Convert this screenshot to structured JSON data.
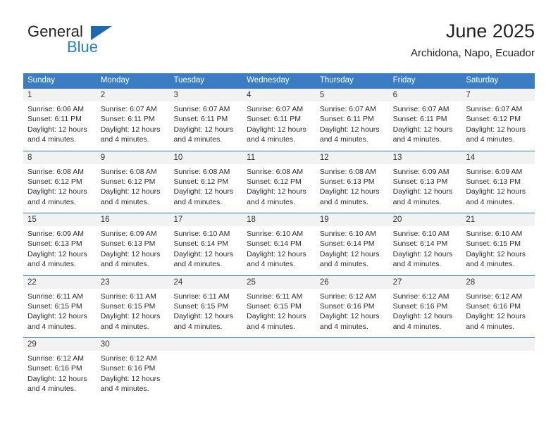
{
  "brand": {
    "name_top": "General",
    "name_bottom": "Blue",
    "triangle_color": "#1c68b3",
    "blue_color": "#1c7fd4"
  },
  "header": {
    "title": "June 2025",
    "subtitle": "Archidona, Napo, Ecuador"
  },
  "theme": {
    "header_blue": "#3a7dc4",
    "day_band_gray": "#f2f2f2",
    "text_color": "#2b2b2b"
  },
  "weekdays": [
    "Sunday",
    "Monday",
    "Tuesday",
    "Wednesday",
    "Thursday",
    "Friday",
    "Saturday"
  ],
  "weeks": [
    [
      {
        "day": "1",
        "sunrise": "Sunrise: 6:06 AM",
        "sunset": "Sunset: 6:11 PM",
        "daylight_1": "Daylight: 12 hours",
        "daylight_2": "and 4 minutes."
      },
      {
        "day": "2",
        "sunrise": "Sunrise: 6:07 AM",
        "sunset": "Sunset: 6:11 PM",
        "daylight_1": "Daylight: 12 hours",
        "daylight_2": "and 4 minutes."
      },
      {
        "day": "3",
        "sunrise": "Sunrise: 6:07 AM",
        "sunset": "Sunset: 6:11 PM",
        "daylight_1": "Daylight: 12 hours",
        "daylight_2": "and 4 minutes."
      },
      {
        "day": "4",
        "sunrise": "Sunrise: 6:07 AM",
        "sunset": "Sunset: 6:11 PM",
        "daylight_1": "Daylight: 12 hours",
        "daylight_2": "and 4 minutes."
      },
      {
        "day": "5",
        "sunrise": "Sunrise: 6:07 AM",
        "sunset": "Sunset: 6:11 PM",
        "daylight_1": "Daylight: 12 hours",
        "daylight_2": "and 4 minutes."
      },
      {
        "day": "6",
        "sunrise": "Sunrise: 6:07 AM",
        "sunset": "Sunset: 6:11 PM",
        "daylight_1": "Daylight: 12 hours",
        "daylight_2": "and 4 minutes."
      },
      {
        "day": "7",
        "sunrise": "Sunrise: 6:07 AM",
        "sunset": "Sunset: 6:12 PM",
        "daylight_1": "Daylight: 12 hours",
        "daylight_2": "and 4 minutes."
      }
    ],
    [
      {
        "day": "8",
        "sunrise": "Sunrise: 6:08 AM",
        "sunset": "Sunset: 6:12 PM",
        "daylight_1": "Daylight: 12 hours",
        "daylight_2": "and 4 minutes."
      },
      {
        "day": "9",
        "sunrise": "Sunrise: 6:08 AM",
        "sunset": "Sunset: 6:12 PM",
        "daylight_1": "Daylight: 12 hours",
        "daylight_2": "and 4 minutes."
      },
      {
        "day": "10",
        "sunrise": "Sunrise: 6:08 AM",
        "sunset": "Sunset: 6:12 PM",
        "daylight_1": "Daylight: 12 hours",
        "daylight_2": "and 4 minutes."
      },
      {
        "day": "11",
        "sunrise": "Sunrise: 6:08 AM",
        "sunset": "Sunset: 6:12 PM",
        "daylight_1": "Daylight: 12 hours",
        "daylight_2": "and 4 minutes."
      },
      {
        "day": "12",
        "sunrise": "Sunrise: 6:08 AM",
        "sunset": "Sunset: 6:13 PM",
        "daylight_1": "Daylight: 12 hours",
        "daylight_2": "and 4 minutes."
      },
      {
        "day": "13",
        "sunrise": "Sunrise: 6:09 AM",
        "sunset": "Sunset: 6:13 PM",
        "daylight_1": "Daylight: 12 hours",
        "daylight_2": "and 4 minutes."
      },
      {
        "day": "14",
        "sunrise": "Sunrise: 6:09 AM",
        "sunset": "Sunset: 6:13 PM",
        "daylight_1": "Daylight: 12 hours",
        "daylight_2": "and 4 minutes."
      }
    ],
    [
      {
        "day": "15",
        "sunrise": "Sunrise: 6:09 AM",
        "sunset": "Sunset: 6:13 PM",
        "daylight_1": "Daylight: 12 hours",
        "daylight_2": "and 4 minutes."
      },
      {
        "day": "16",
        "sunrise": "Sunrise: 6:09 AM",
        "sunset": "Sunset: 6:13 PM",
        "daylight_1": "Daylight: 12 hours",
        "daylight_2": "and 4 minutes."
      },
      {
        "day": "17",
        "sunrise": "Sunrise: 6:10 AM",
        "sunset": "Sunset: 6:14 PM",
        "daylight_1": "Daylight: 12 hours",
        "daylight_2": "and 4 minutes."
      },
      {
        "day": "18",
        "sunrise": "Sunrise: 6:10 AM",
        "sunset": "Sunset: 6:14 PM",
        "daylight_1": "Daylight: 12 hours",
        "daylight_2": "and 4 minutes."
      },
      {
        "day": "19",
        "sunrise": "Sunrise: 6:10 AM",
        "sunset": "Sunset: 6:14 PM",
        "daylight_1": "Daylight: 12 hours",
        "daylight_2": "and 4 minutes."
      },
      {
        "day": "20",
        "sunrise": "Sunrise: 6:10 AM",
        "sunset": "Sunset: 6:14 PM",
        "daylight_1": "Daylight: 12 hours",
        "daylight_2": "and 4 minutes."
      },
      {
        "day": "21",
        "sunrise": "Sunrise: 6:10 AM",
        "sunset": "Sunset: 6:15 PM",
        "daylight_1": "Daylight: 12 hours",
        "daylight_2": "and 4 minutes."
      }
    ],
    [
      {
        "day": "22",
        "sunrise": "Sunrise: 6:11 AM",
        "sunset": "Sunset: 6:15 PM",
        "daylight_1": "Daylight: 12 hours",
        "daylight_2": "and 4 minutes."
      },
      {
        "day": "23",
        "sunrise": "Sunrise: 6:11 AM",
        "sunset": "Sunset: 6:15 PM",
        "daylight_1": "Daylight: 12 hours",
        "daylight_2": "and 4 minutes."
      },
      {
        "day": "24",
        "sunrise": "Sunrise: 6:11 AM",
        "sunset": "Sunset: 6:15 PM",
        "daylight_1": "Daylight: 12 hours",
        "daylight_2": "and 4 minutes."
      },
      {
        "day": "25",
        "sunrise": "Sunrise: 6:11 AM",
        "sunset": "Sunset: 6:15 PM",
        "daylight_1": "Daylight: 12 hours",
        "daylight_2": "and 4 minutes."
      },
      {
        "day": "26",
        "sunrise": "Sunrise: 6:12 AM",
        "sunset": "Sunset: 6:16 PM",
        "daylight_1": "Daylight: 12 hours",
        "daylight_2": "and 4 minutes."
      },
      {
        "day": "27",
        "sunrise": "Sunrise: 6:12 AM",
        "sunset": "Sunset: 6:16 PM",
        "daylight_1": "Daylight: 12 hours",
        "daylight_2": "and 4 minutes."
      },
      {
        "day": "28",
        "sunrise": "Sunrise: 6:12 AM",
        "sunset": "Sunset: 6:16 PM",
        "daylight_1": "Daylight: 12 hours",
        "daylight_2": "and 4 minutes."
      }
    ],
    [
      {
        "day": "29",
        "sunrise": "Sunrise: 6:12 AM",
        "sunset": "Sunset: 6:16 PM",
        "daylight_1": "Daylight: 12 hours",
        "daylight_2": "and 4 minutes."
      },
      {
        "day": "30",
        "sunrise": "Sunrise: 6:12 AM",
        "sunset": "Sunset: 6:16 PM",
        "daylight_1": "Daylight: 12 hours",
        "daylight_2": "and 4 minutes."
      },
      {
        "day": "",
        "sunrise": "",
        "sunset": "",
        "daylight_1": "",
        "daylight_2": ""
      },
      {
        "day": "",
        "sunrise": "",
        "sunset": "",
        "daylight_1": "",
        "daylight_2": ""
      },
      {
        "day": "",
        "sunrise": "",
        "sunset": "",
        "daylight_1": "",
        "daylight_2": ""
      },
      {
        "day": "",
        "sunrise": "",
        "sunset": "",
        "daylight_1": "",
        "daylight_2": ""
      },
      {
        "day": "",
        "sunrise": "",
        "sunset": "",
        "daylight_1": "",
        "daylight_2": ""
      }
    ]
  ]
}
